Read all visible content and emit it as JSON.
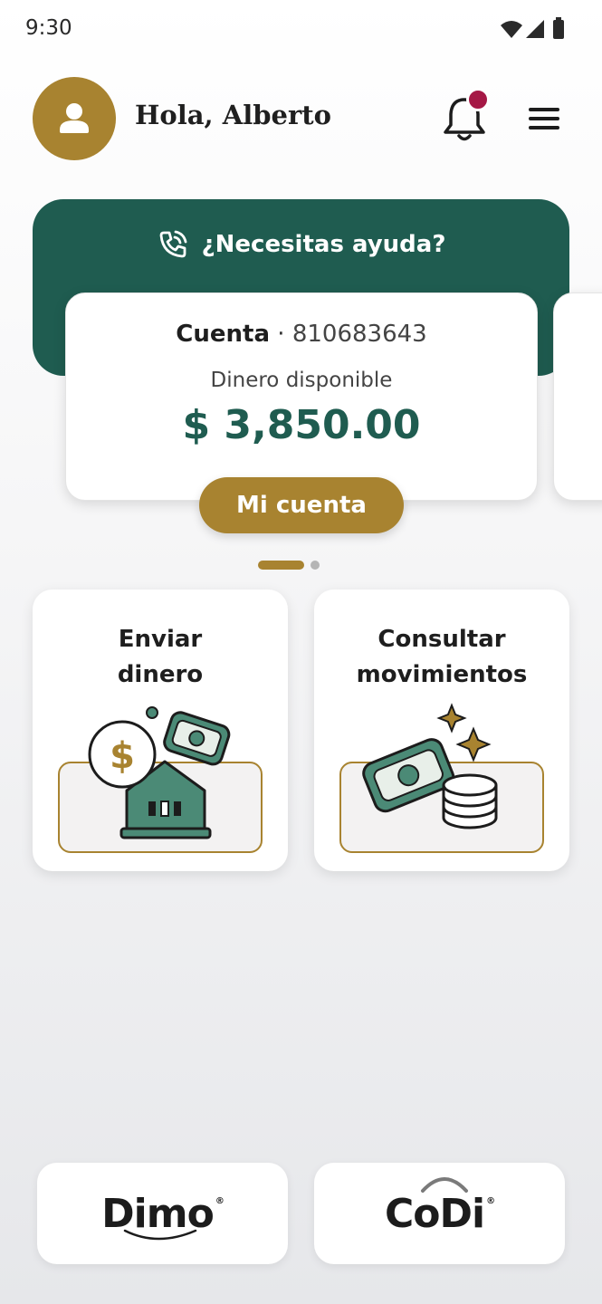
{
  "status_bar": {
    "time": "9:30"
  },
  "header": {
    "greeting": "Hola, Alberto"
  },
  "help_banner": {
    "text": "¿Necesitas ayuda?"
  },
  "account": {
    "label": "Cuenta",
    "separator": "·",
    "number": "810683643",
    "available_label": "Dinero disponible",
    "balance": "$ 3,850.00",
    "button_label": "Mi cuenta"
  },
  "actions": {
    "send_money": "Enviar\ndinero",
    "movements": "Consultar\nmovimientos"
  },
  "bottom": {
    "dimo": "Dimo",
    "codi": "CoDi",
    "registered_mark": "®"
  },
  "colors": {
    "brand_green": "#1f5c50",
    "brand_gold": "#a88330",
    "notification": "#a51845"
  }
}
